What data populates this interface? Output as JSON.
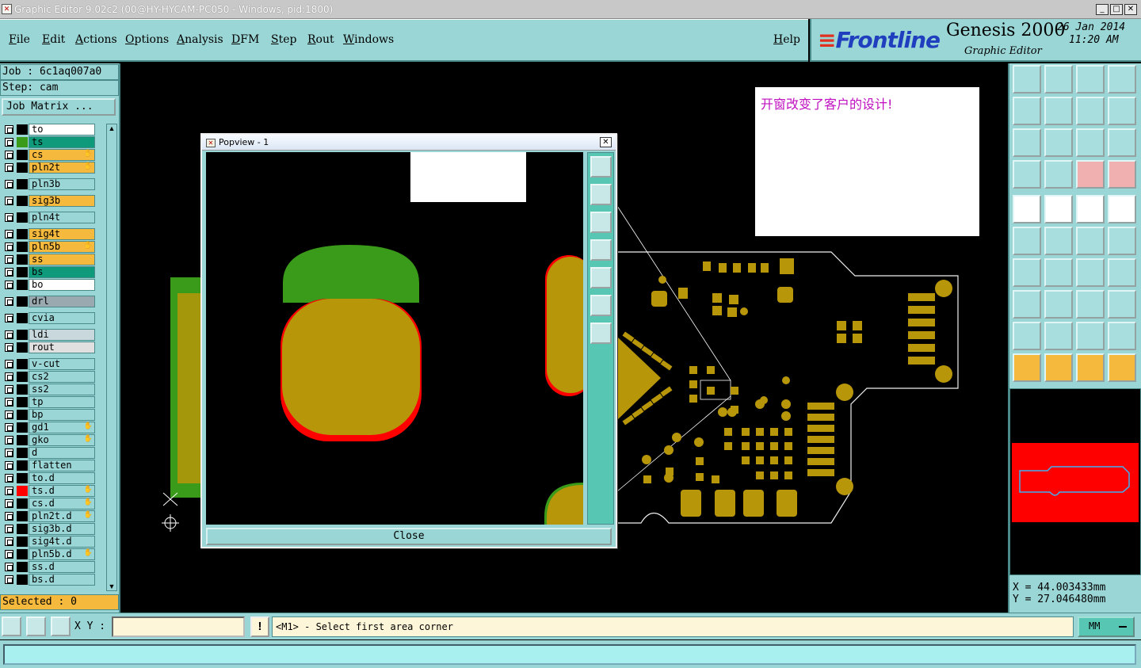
{
  "window": {
    "title": "Graphic Editor 9.02c2 (00@HY-HYCAM-PC050 - Windows, pid:1800)"
  },
  "menu": {
    "file": "File",
    "edit": "Edit",
    "actions": "Actions",
    "options": "Options",
    "analysis": "Analysis",
    "dfm": "DFM",
    "step": "Step",
    "rout": "Rout",
    "windows": "Windows",
    "help": "Help"
  },
  "brand": {
    "logo": "Frontline",
    "product": "Genesis 2000",
    "module": "Graphic Editor",
    "date": "26 Jan 2014",
    "time": "11:20 AM"
  },
  "job": {
    "job_line": "Job : 6c1aq007a0",
    "step_line": "Step: cam",
    "matrix_button": "Job Matrix ..."
  },
  "layers": [
    {
      "name": "to",
      "color": "#ffffff",
      "swatch": "#000000"
    },
    {
      "name": "ts",
      "color": "#0f9a7c",
      "swatch": "#3a9a1a"
    },
    {
      "name": "cs",
      "color": "#f5b93d",
      "swatch": "#000000",
      "hand": true
    },
    {
      "name": "pln2t",
      "color": "#f5b93d",
      "swatch": "#000000",
      "hand": true
    },
    {
      "name": "pln3b",
      "color": "#9bd6d6",
      "swatch": "#000000"
    },
    {
      "name": "sig3b",
      "color": "#f5b93d",
      "swatch": "#000000"
    },
    {
      "name": "pln4t",
      "color": "#9bd6d6",
      "swatch": "#000000"
    },
    {
      "name": "sig4t",
      "color": "#f5b93d",
      "swatch": "#000000"
    },
    {
      "name": "pln5b",
      "color": "#f5b93d",
      "swatch": "#000000",
      "hand": true
    },
    {
      "name": "ss",
      "color": "#f5b93d",
      "swatch": "#000000"
    },
    {
      "name": "bs",
      "color": "#0f9a7c",
      "swatch": "#000000"
    },
    {
      "name": "bo",
      "color": "#ffffff",
      "swatch": "#000000"
    },
    {
      "name": "drl",
      "color": "#9aa8b0",
      "swatch": "#000000"
    },
    {
      "name": "cvia",
      "color": "#9bd6d6",
      "swatch": "#000000"
    },
    {
      "name": "ldi",
      "color": "#c8d8dc",
      "swatch": "#000000"
    },
    {
      "name": "rout",
      "color": "#e0e0e0",
      "swatch": "#000000"
    },
    {
      "name": "v-cut",
      "color": "#9bd6d6",
      "swatch": "#000000"
    },
    {
      "name": "cs2",
      "color": "#9bd6d6",
      "swatch": "#000000"
    },
    {
      "name": "ss2",
      "color": "#9bd6d6",
      "swatch": "#000000"
    },
    {
      "name": "tp",
      "color": "#9bd6d6",
      "swatch": "#000000"
    },
    {
      "name": "bp",
      "color": "#9bd6d6",
      "swatch": "#000000"
    },
    {
      "name": "gd1",
      "color": "#9bd6d6",
      "swatch": "#000000",
      "hand": true
    },
    {
      "name": "gko",
      "color": "#9bd6d6",
      "swatch": "#000000",
      "hand": true
    },
    {
      "name": "d",
      "color": "#9bd6d6",
      "swatch": "#000000"
    },
    {
      "name": "flatten",
      "color": "#9bd6d6",
      "swatch": "#000000"
    },
    {
      "name": "to.d",
      "color": "#9bd6d6",
      "swatch": "#000000"
    },
    {
      "name": "ts.d",
      "color": "#9bd6d6",
      "swatch": "#ff0000",
      "hand": true
    },
    {
      "name": "cs.d",
      "color": "#9bd6d6",
      "swatch": "#000000",
      "hand": true
    },
    {
      "name": "pln2t.d",
      "color": "#9bd6d6",
      "swatch": "#000000",
      "hand": true
    },
    {
      "name": "sig3b.d",
      "color": "#9bd6d6",
      "swatch": "#000000"
    },
    {
      "name": "sig4t.d",
      "color": "#9bd6d6",
      "swatch": "#000000"
    },
    {
      "name": "pln5b.d",
      "color": "#9bd6d6",
      "swatch": "#000000",
      "hand": true
    },
    {
      "name": "ss.d",
      "color": "#9bd6d6",
      "swatch": "#000000"
    },
    {
      "name": "bs.d",
      "color": "#9bd6d6",
      "swatch": "#000000"
    }
  ],
  "selected": "Selected : 0",
  "note": {
    "text": "开窗改变了客户的设计!"
  },
  "popview": {
    "title": "Popview - 1",
    "close_label": "Close"
  },
  "coords": {
    "x": "X = 44.003433mm",
    "y": "Y = 27.046480mm"
  },
  "bottom": {
    "xy_label": "X Y :",
    "xy_value": "",
    "warn": "!",
    "prompt": "<M1> - Select first area corner",
    "units": "MM"
  },
  "colors": {
    "panel": "#9bd6d6",
    "pad": "#b8960a",
    "green": "#3a9a1a",
    "red": "#ff0000"
  }
}
